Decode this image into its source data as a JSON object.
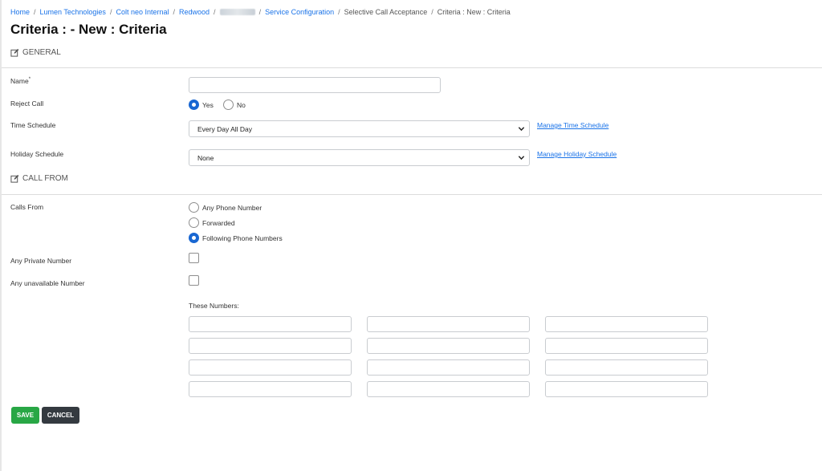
{
  "breadcrumb": {
    "items": [
      "Home",
      "Lumen Technologies",
      "Colt neo Internal",
      "Redwood"
    ],
    "after_blur": [
      "Service Configuration"
    ],
    "current": [
      "Selective Call Acceptance",
      "Criteria : New : Criteria"
    ]
  },
  "page_title": "Criteria : - New : Criteria",
  "sections": {
    "general": "GENERAL",
    "call_from": "CALL FROM"
  },
  "icons": {
    "section": "edit-icon",
    "select": "chevron-down-icon"
  },
  "colors": {
    "accent": "#1967d2",
    "link": "#1a73e8",
    "save": "#28a745",
    "cancel": "#343a40"
  },
  "form": {
    "name_label": "Name",
    "name_required_mark": "*",
    "name_value": "",
    "reject_call_label": "Reject Call",
    "reject_options": [
      {
        "label": "Yes",
        "selected": true
      },
      {
        "label": "No",
        "selected": false
      }
    ],
    "time_schedule_label": "Time Schedule",
    "time_schedule_value": "Every Day All Day",
    "manage_time_link": "Manage Time Schedule",
    "holiday_schedule_label": "Holiday Schedule",
    "holiday_schedule_value": "None",
    "manage_holiday_link": "Manage Holiday Schedule",
    "calls_from_label": "Calls From",
    "calls_from_options": [
      {
        "label": "Any Phone Number",
        "selected": false
      },
      {
        "label": "Forwarded",
        "selected": false
      },
      {
        "label": "Following Phone Numbers",
        "selected": true
      }
    ],
    "private_label": "Any Private Number",
    "private_checked": false,
    "unavailable_label": "Any unavailable Number",
    "unavailable_checked": false,
    "these_numbers_label": "These Numbers:",
    "these_numbers": [
      "",
      "",
      "",
      "",
      "",
      "",
      "",
      "",
      "",
      "",
      "",
      ""
    ]
  },
  "buttons": {
    "save": "SAVE",
    "cancel": "CANCEL"
  }
}
